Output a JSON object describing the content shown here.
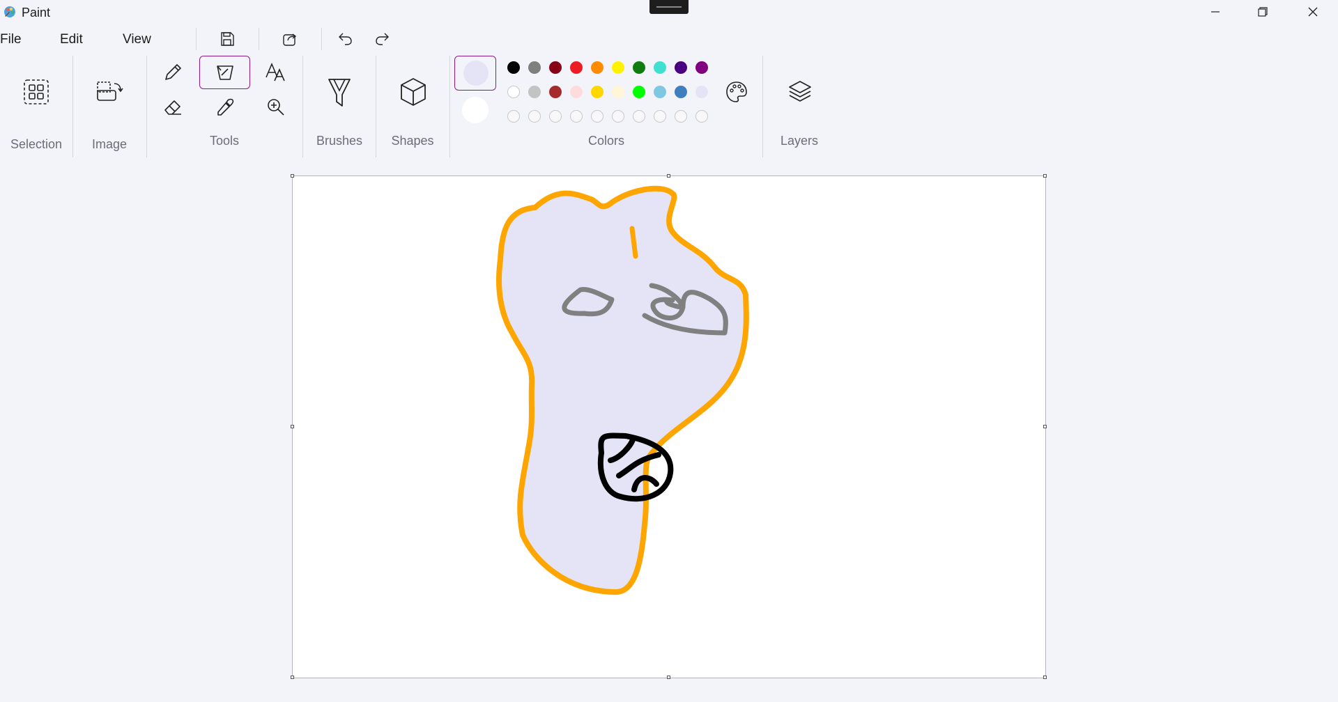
{
  "window": {
    "title": "Paint"
  },
  "menu": {
    "file": "File",
    "edit": "Edit",
    "view": "View"
  },
  "ribbon": {
    "selection": "Selection",
    "image": "Image",
    "tools": "Tools",
    "brushes": "Brushes",
    "shapes": "Shapes",
    "colors": "Colors",
    "layers": "Layers"
  },
  "colors": {
    "primary": "#e4e4f6",
    "secondary": "#ffffff",
    "palette_row1": [
      "#000000",
      "#7f7f7f",
      "#880015",
      "#ed1c24",
      "#ff8c00",
      "#fff200",
      "#107c10",
      "#40e0d0",
      "#4b0082",
      "#800080"
    ],
    "palette_row2": [
      "#ffffff",
      "#c3c3c3",
      "#a52a2a",
      "#ffdcdc",
      "#ffd700",
      "#fff5d7",
      "#00ff00",
      "#7ec8e3",
      "#3f7fbf",
      "#e4e4f6"
    ],
    "custom_row_count": 10
  },
  "drawing": {
    "outline_color": "#ffa500",
    "fill_color": "#e4e4f6",
    "eye_color": "#808080",
    "mouth_color": "#000000"
  }
}
